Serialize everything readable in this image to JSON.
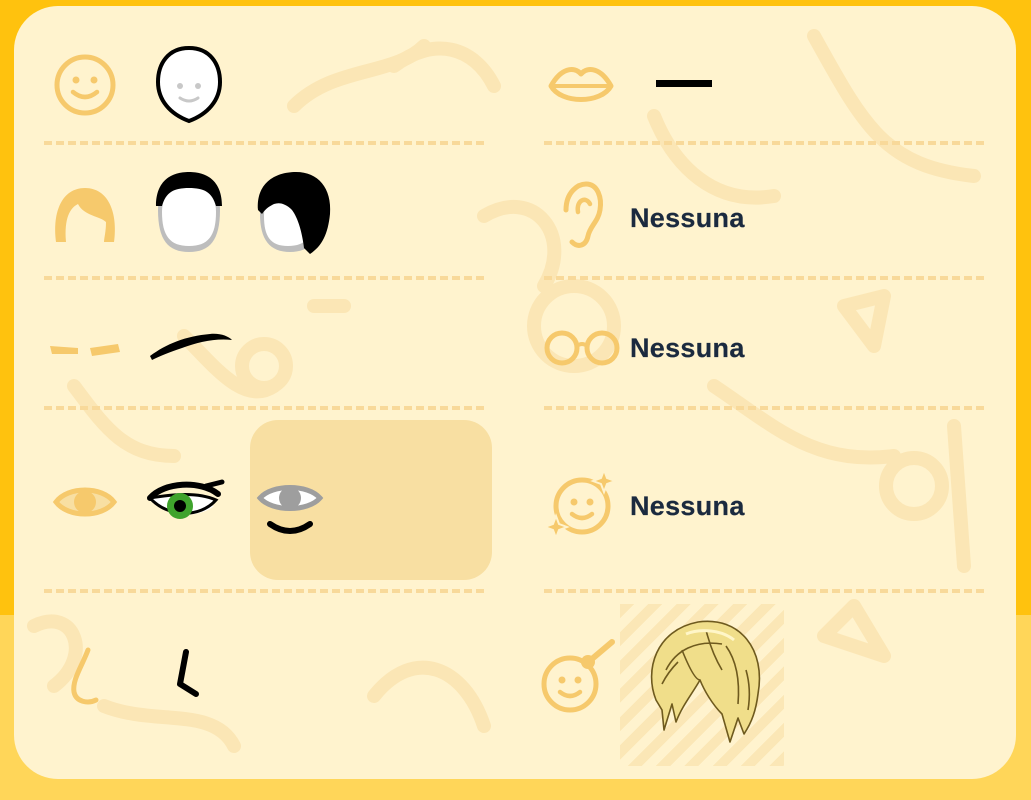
{
  "categories": {
    "face": {
      "icon": "smiley-face-icon",
      "options": [
        "face-shape-white-icon"
      ]
    },
    "hair": {
      "icon": "hair-icon",
      "options": [
        "hair-short-black-icon",
        "hair-bob-black-icon"
      ]
    },
    "eyebrows": {
      "icon": "eyebrows-icon",
      "options": [
        "eyebrow-black-icon"
      ]
    },
    "eyes": {
      "icon": "eye-icon",
      "options": [
        "eye-green-icon",
        "eye-gray-selected-icon"
      ]
    },
    "nose": {
      "icon": "nose-icon",
      "options": [
        "nose-black-icon"
      ]
    },
    "mouth": {
      "icon": "lips-icon",
      "options": [
        "mouth-line-icon"
      ]
    },
    "ears": {
      "icon": "ear-icon",
      "value": "Nessuna"
    },
    "glasses": {
      "icon": "glasses-icon",
      "value": "Nessuna"
    },
    "makeup": {
      "icon": "sparkle-face-icon",
      "value": "Nessuna"
    },
    "accessory": {
      "icon": "wand-face-icon",
      "options": [
        "blonde-wig-icon"
      ]
    }
  },
  "colors": {
    "background": "#FFC20E",
    "panel": "#FFF3CE",
    "icon": "#F6C96C",
    "selection": "#F8DFA2",
    "text": "#1B2A3F",
    "eye_iris": "#3FA32C"
  }
}
